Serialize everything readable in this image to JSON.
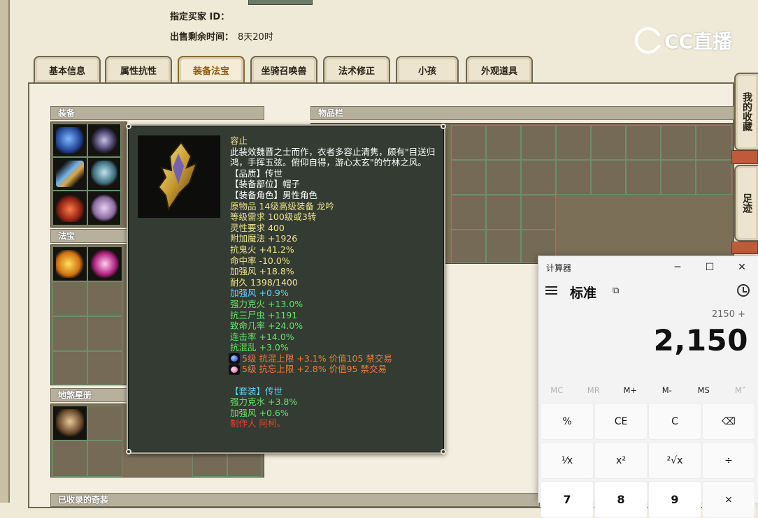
{
  "seller": {
    "buyer_label": "指定买家 ID：",
    "buyer_value": "",
    "time_label": "出售剩余时间：",
    "time_value": "8天20时"
  },
  "watermark": {
    "text": "CC直播"
  },
  "tabs": [
    {
      "label": "基本信息",
      "active": false
    },
    {
      "label": "属性抗性",
      "active": false
    },
    {
      "label": "装备法宝",
      "active": true
    },
    {
      "label": "坐骑召唤兽",
      "active": false
    },
    {
      "label": "法术修正",
      "active": false
    },
    {
      "label": "小孩",
      "active": false
    },
    {
      "label": "外观道具",
      "active": false
    }
  ],
  "sections": {
    "equipment": "装备",
    "treasure": "法宝",
    "star_book": "地煞星册",
    "inventory": "物品栏",
    "collected": "已收录的奇装"
  },
  "side_tabs": {
    "favorites": "我的收藏",
    "footprint": "足迹"
  },
  "tooltip": {
    "lines": [
      {
        "text": "容止",
        "color": "yellow"
      },
      {
        "text": "此装效魏晋之士而作，衣者多容止清隽，颇有\"目送归鸿，手挥五弦。俯仰自得，游心太玄\"的竹林之风。",
        "color": "white",
        "wrap": true
      },
      {
        "text": "【品质】传世",
        "color": "white"
      },
      {
        "text": "【装备部位】帽子",
        "color": "white"
      },
      {
        "text": "【装备角色】男性角色",
        "color": "white"
      },
      {
        "text": "原物品 14级高级装备 龙吟",
        "color": "yellow"
      },
      {
        "text": "等级需求 100级或3转",
        "color": "yellow"
      },
      {
        "text": "灵性要求 400",
        "color": "yellow"
      },
      {
        "text": "附加魔法 +1926",
        "color": "yellow"
      },
      {
        "text": "抗鬼火 +41.2%",
        "color": "yellow"
      },
      {
        "text": "命中率 -10.0%",
        "color": "yellow"
      },
      {
        "text": "加强风 +18.8%",
        "color": "yellow"
      },
      {
        "text": "耐久 1398/1400",
        "color": "yellow"
      },
      {
        "text": "加强风 +0.9%",
        "color": "cyan"
      },
      {
        "text": "强力克火 +13.0%",
        "color": "green"
      },
      {
        "text": "抗三尸虫 +1191",
        "color": "green"
      },
      {
        "text": "致命几率 +24.0%",
        "color": "green"
      },
      {
        "text": "连击率 +14.0%",
        "color": "green"
      },
      {
        "text": "抗混乱 +3.0%",
        "color": "green"
      },
      {
        "text": "5级 抗混上限 +3.1% 价值105 禁交易",
        "color": "orange",
        "gem": "blue"
      },
      {
        "text": "5级 抗忘上限 +2.8% 价值95 禁交易",
        "color": "orange",
        "gem": "pink"
      },
      {
        "text": "",
        "color": "white"
      },
      {
        "text": "【套装】传世",
        "color": "cyan"
      },
      {
        "text": "强力克水 +3.8%",
        "color": "green"
      },
      {
        "text": "加强风 +0.6%",
        "color": "green"
      },
      {
        "text": "制作人 阿柯。",
        "color": "red"
      }
    ]
  },
  "calculator": {
    "title": "计算器",
    "mode": "标准",
    "expression": "2150 +",
    "display": "2,150",
    "memory": [
      {
        "label": "MC",
        "enabled": false
      },
      {
        "label": "MR",
        "enabled": false
      },
      {
        "label": "M+",
        "enabled": true
      },
      {
        "label": "M-",
        "enabled": true
      },
      {
        "label": "MS",
        "enabled": true
      },
      {
        "label": "M˅",
        "enabled": false
      }
    ],
    "keys": [
      {
        "label": "%",
        "name": "percent-key"
      },
      {
        "label": "CE",
        "name": "clear-entry-key"
      },
      {
        "label": "C",
        "name": "clear-key"
      },
      {
        "label": "⌫",
        "name": "backspace-key"
      },
      {
        "label": "¹⁄x",
        "name": "reciprocal-key"
      },
      {
        "label": "x²",
        "name": "square-key"
      },
      {
        "label": "²√x",
        "name": "sqrt-key"
      },
      {
        "label": "÷",
        "name": "divide-key"
      },
      {
        "label": "7",
        "name": "digit-7-key",
        "num": true
      },
      {
        "label": "8",
        "name": "digit-8-key",
        "num": true
      },
      {
        "label": "9",
        "name": "digit-9-key",
        "num": true
      },
      {
        "label": "×",
        "name": "multiply-key"
      }
    ]
  }
}
